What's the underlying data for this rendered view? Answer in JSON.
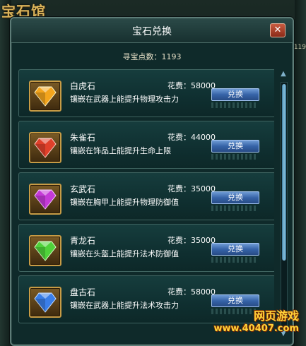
{
  "background": {
    "title_fragment": "宝石馆",
    "right_number": "119"
  },
  "dialog": {
    "title": "宝石兑换",
    "close_glyph": "✕",
    "points_text": "寻宝点数：1193"
  },
  "gems": [
    {
      "name": "白虎石",
      "description": "镶嵌在武器上能提升物理攻击力",
      "cost": "花费：58000",
      "button": "兑换",
      "color": "#f3a51d",
      "icon": "gem-orange-icon"
    },
    {
      "name": "朱雀石",
      "description": "镶嵌在饰品上能提升生命上限",
      "cost": "花费：44000",
      "button": "兑换",
      "color": "#e0402a",
      "icon": "gem-red-icon"
    },
    {
      "name": "玄武石",
      "description": "镶嵌在胸甲上能提升物理防御值",
      "cost": "花费：35000",
      "button": "兑换",
      "color": "#c53ad8",
      "icon": "gem-purple-icon"
    },
    {
      "name": "青龙石",
      "description": "镶嵌在头盔上能提升法术防御值",
      "cost": "花费：35000",
      "button": "兑换",
      "color": "#4fd23a",
      "icon": "gem-green-icon"
    },
    {
      "name": "盘古石",
      "description": "镶嵌在武器上能提升法术攻击力",
      "cost": "花费：58000",
      "button": "兑换",
      "color": "#3a7ee8",
      "icon": "gem-blue-icon"
    }
  ],
  "watermark": {
    "line1": "网页游戏",
    "line2": "www.40407.com"
  }
}
